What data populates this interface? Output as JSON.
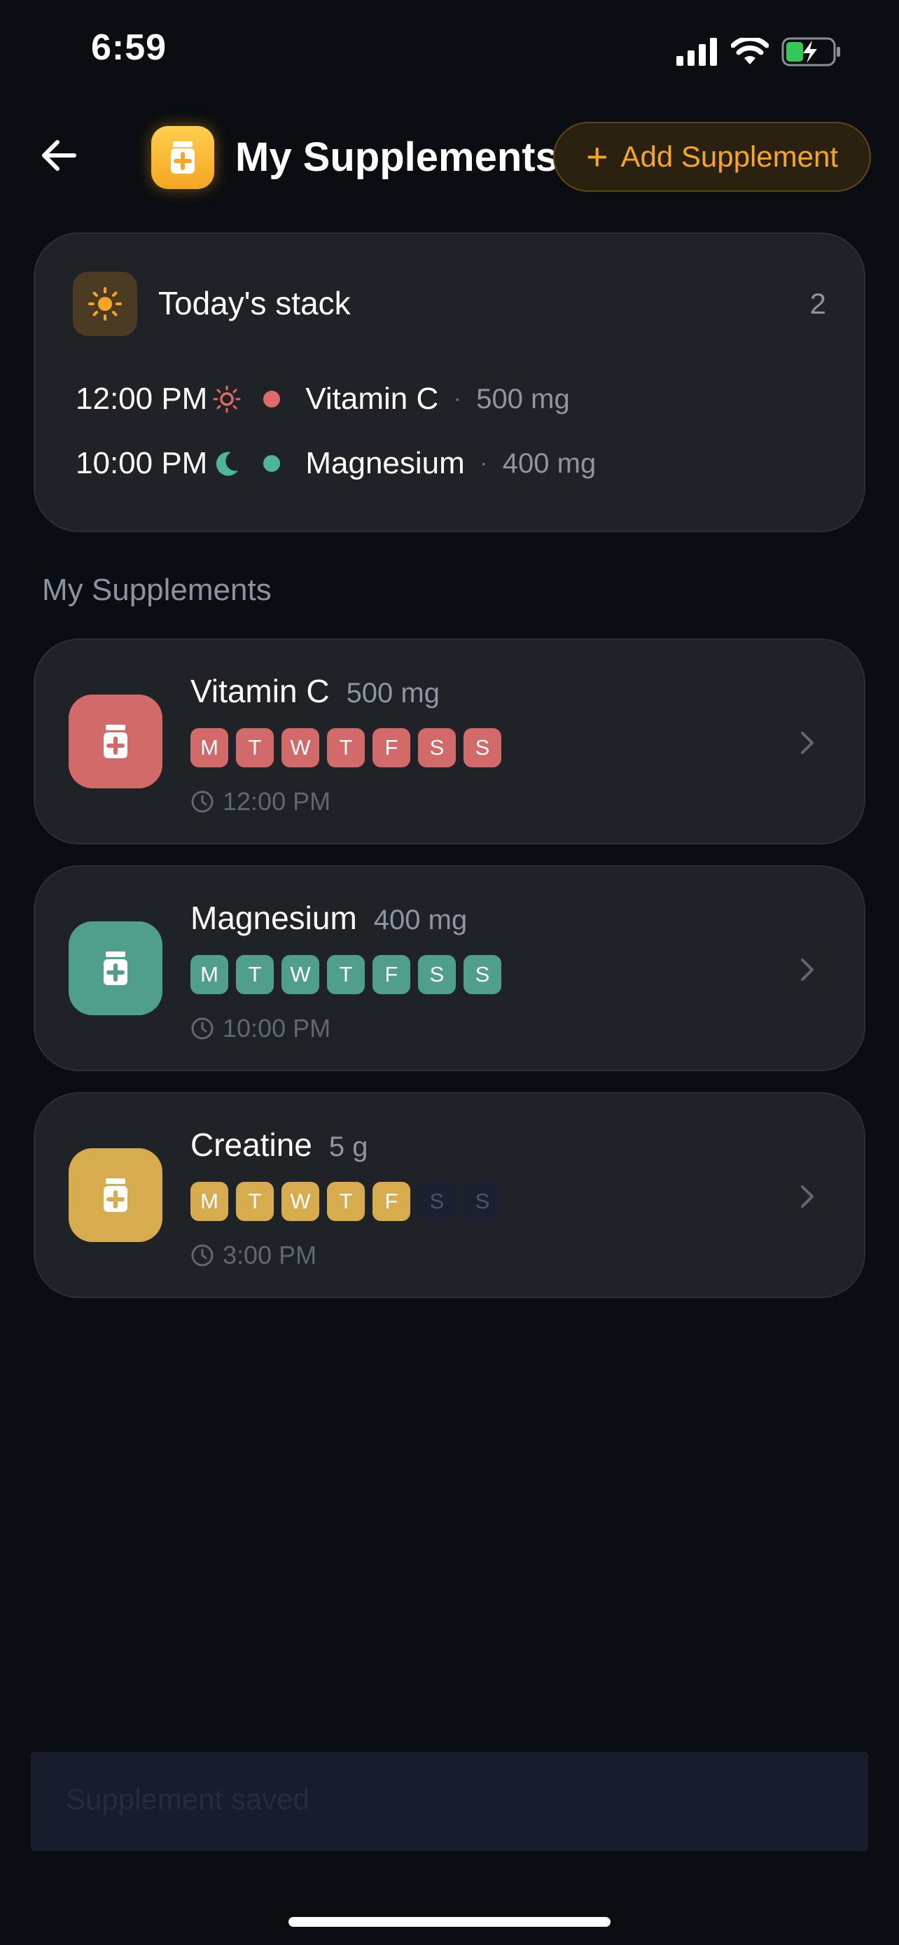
{
  "status_bar": {
    "time": "6:59"
  },
  "header": {
    "title": "My Supplements",
    "add_button_label": "Add Supplement"
  },
  "todays_stack": {
    "title": "Today's stack",
    "count": "2",
    "items": [
      {
        "time": "12:00 PM",
        "period_icon": "sun-icon",
        "dot_color": "#e06a6a",
        "name": "Vitamin C",
        "separator": "·",
        "dose": "500 mg"
      },
      {
        "time": "10:00 PM",
        "period_icon": "moon-icon",
        "dot_color": "#4fb59a",
        "name": "Magnesium",
        "separator": "·",
        "dose": "400 mg"
      }
    ]
  },
  "section_label": "My Supplements",
  "supplements": [
    {
      "name": "Vitamin C",
      "dose": "500 mg",
      "color": "#d36a6a",
      "time": "12:00 PM",
      "days": [
        {
          "l": "M",
          "on": true
        },
        {
          "l": "T",
          "on": true
        },
        {
          "l": "W",
          "on": true
        },
        {
          "l": "T",
          "on": true
        },
        {
          "l": "F",
          "on": true
        },
        {
          "l": "S",
          "on": true
        },
        {
          "l": "S",
          "on": true
        }
      ]
    },
    {
      "name": "Magnesium",
      "dose": "400 mg",
      "color": "#4f9f8c",
      "time": "10:00 PM",
      "days": [
        {
          "l": "M",
          "on": true
        },
        {
          "l": "T",
          "on": true
        },
        {
          "l": "W",
          "on": true
        },
        {
          "l": "T",
          "on": true
        },
        {
          "l": "F",
          "on": true
        },
        {
          "l": "S",
          "on": true
        },
        {
          "l": "S",
          "on": true
        }
      ]
    },
    {
      "name": "Creatine",
      "dose": "5 g",
      "color": "#d6ac4e",
      "time": "3:00 PM",
      "days": [
        {
          "l": "M",
          "on": true
        },
        {
          "l": "T",
          "on": true
        },
        {
          "l": "W",
          "on": true
        },
        {
          "l": "T",
          "on": true
        },
        {
          "l": "F",
          "on": true
        },
        {
          "l": "S",
          "on": false
        },
        {
          "l": "S",
          "on": false
        }
      ]
    }
  ],
  "toast": {
    "message": "Supplement saved"
  },
  "colors": {
    "accent": "#f5a623",
    "background": "#0a0d11",
    "card": "#1f2226"
  }
}
